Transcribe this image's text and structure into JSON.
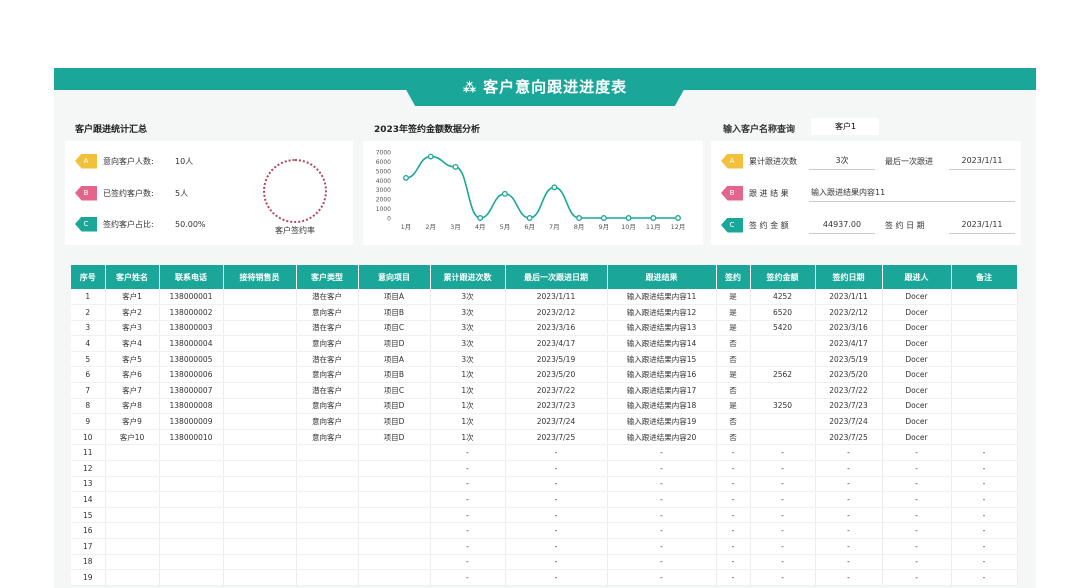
{
  "title": "客户意向跟进进度表",
  "title_icon": "sparkle-icon",
  "colors": {
    "accent": "#1aa79a",
    "badge_a": "#f2c13b",
    "badge_b": "#e2668c",
    "badge_c": "#1aa79a"
  },
  "summary": {
    "heading": "客户跟进统计汇总",
    "items": [
      {
        "badge": "A",
        "label": "意向客户人数:",
        "value": "10人"
      },
      {
        "badge": "B",
        "label": "已签约客户数:",
        "value": "5人"
      },
      {
        "badge": "C",
        "label": "签约客户占比:",
        "value": "50.00%"
      }
    ],
    "ring_label": "客户签约率"
  },
  "chart_heading": "2023年签约金额数据分析",
  "chart_data": {
    "type": "line",
    "title": "2023年签约金额数据分析",
    "categories": [
      "1月",
      "2月",
      "3月",
      "4月",
      "5月",
      "6月",
      "7月",
      "8月",
      "9月",
      "10月",
      "11月",
      "12月"
    ],
    "values": [
      4252,
      6520,
      5420,
      0,
      2562,
      0,
      3250,
      0,
      0,
      0,
      0,
      0
    ],
    "ylim": [
      0,
      7000
    ],
    "yticks": [
      0,
      1000,
      2000,
      3000,
      4000,
      5000,
      6000,
      7000
    ],
    "grid": false
  },
  "query": {
    "label": "输入客户名称查询",
    "value": "客户1",
    "rows": [
      {
        "badge": "A",
        "label": "累计跟进次数",
        "value": "3次",
        "label2": "最后一次跟进",
        "value2": "2023/1/11"
      },
      {
        "badge": "B",
        "label": "跟 进 结 果",
        "value": "输入跟进结果内容11"
      },
      {
        "badge": "C",
        "label": "签 约 金 额",
        "value": "44937.00",
        "label2": "签 约 日 期",
        "value2": "2023/1/11"
      }
    ]
  },
  "table": {
    "headers": [
      "序号",
      "客户姓名",
      "联系电话",
      "接待销售员",
      "客户类型",
      "意向项目",
      "累计跟进次数",
      "最后一次跟进日期",
      "跟进结果",
      "签约",
      "签约金额",
      "签约日期",
      "跟进人",
      "备注"
    ],
    "rows": [
      [
        "1",
        "客户1",
        "138000001",
        "",
        "潜在客户",
        "项目A",
        "3次",
        "2023/1/11",
        "输入跟进结果内容11",
        "是",
        "4252",
        "2023/1/11",
        "Docer",
        ""
      ],
      [
        "2",
        "客户2",
        "138000002",
        "",
        "意向客户",
        "项目B",
        "3次",
        "2023/2/12",
        "输入跟进结果内容12",
        "是",
        "6520",
        "2023/2/12",
        "Docer",
        ""
      ],
      [
        "3",
        "客户3",
        "138000003",
        "",
        "潜在客户",
        "项目C",
        "3次",
        "2023/3/16",
        "输入跟进结果内容13",
        "是",
        "5420",
        "2023/3/16",
        "Docer",
        ""
      ],
      [
        "4",
        "客户4",
        "138000004",
        "",
        "意向客户",
        "项目D",
        "3次",
        "2023/4/17",
        "输入跟进结果内容14",
        "否",
        "",
        "2023/4/17",
        "Docer",
        ""
      ],
      [
        "5",
        "客户5",
        "138000005",
        "",
        "潜在客户",
        "项目A",
        "3次",
        "2023/5/19",
        "输入跟进结果内容15",
        "否",
        "",
        "2023/5/19",
        "Docer",
        ""
      ],
      [
        "6",
        "客户6",
        "138000006",
        "",
        "意向客户",
        "项目B",
        "1次",
        "2023/5/20",
        "输入跟进结果内容16",
        "是",
        "2562",
        "2023/5/20",
        "Docer",
        ""
      ],
      [
        "7",
        "客户7",
        "138000007",
        "",
        "潜在客户",
        "项目C",
        "1次",
        "2023/7/22",
        "输入跟进结果内容17",
        "否",
        "",
        "2023/7/22",
        "Docer",
        ""
      ],
      [
        "8",
        "客户8",
        "138000008",
        "",
        "意向客户",
        "项目D",
        "1次",
        "2023/7/23",
        "输入跟进结果内容18",
        "是",
        "3250",
        "2023/7/23",
        "Docer",
        ""
      ],
      [
        "9",
        "客户9",
        "138000009",
        "",
        "意向客户",
        "项目D",
        "1次",
        "2023/7/24",
        "输入跟进结果内容19",
        "否",
        "",
        "2023/7/24",
        "Docer",
        ""
      ],
      [
        "10",
        "客户10",
        "138000010",
        "",
        "意向客户",
        "项目D",
        "1次",
        "2023/7/25",
        "输入跟进结果内容20",
        "否",
        "",
        "2023/7/25",
        "Docer",
        ""
      ],
      [
        "11",
        "",
        "",
        "",
        "",
        "",
        "-",
        "-",
        "-",
        "-",
        "-",
        "-",
        "-",
        "-"
      ],
      [
        "12",
        "",
        "",
        "",
        "",
        "",
        "-",
        "-",
        "-",
        "-",
        "-",
        "-",
        "-",
        "-"
      ],
      [
        "13",
        "",
        "",
        "",
        "",
        "",
        "-",
        "-",
        "-",
        "-",
        "-",
        "-",
        "-",
        "-"
      ],
      [
        "14",
        "",
        "",
        "",
        "",
        "",
        "-",
        "-",
        "-",
        "-",
        "-",
        "-",
        "-",
        "-"
      ],
      [
        "15",
        "",
        "",
        "",
        "",
        "",
        "-",
        "-",
        "-",
        "-",
        "-",
        "-",
        "-",
        "-"
      ],
      [
        "16",
        "",
        "",
        "",
        "",
        "",
        "-",
        "-",
        "-",
        "-",
        "-",
        "-",
        "-",
        "-"
      ],
      [
        "17",
        "",
        "",
        "",
        "",
        "",
        "-",
        "-",
        "-",
        "-",
        "-",
        "-",
        "-",
        "-"
      ],
      [
        "18",
        "",
        "",
        "",
        "",
        "",
        "-",
        "-",
        "-",
        "-",
        "-",
        "-",
        "-",
        "-"
      ],
      [
        "19",
        "",
        "",
        "",
        "",
        "",
        "-",
        "-",
        "-",
        "-",
        "-",
        "-",
        "-",
        "-"
      ]
    ]
  }
}
